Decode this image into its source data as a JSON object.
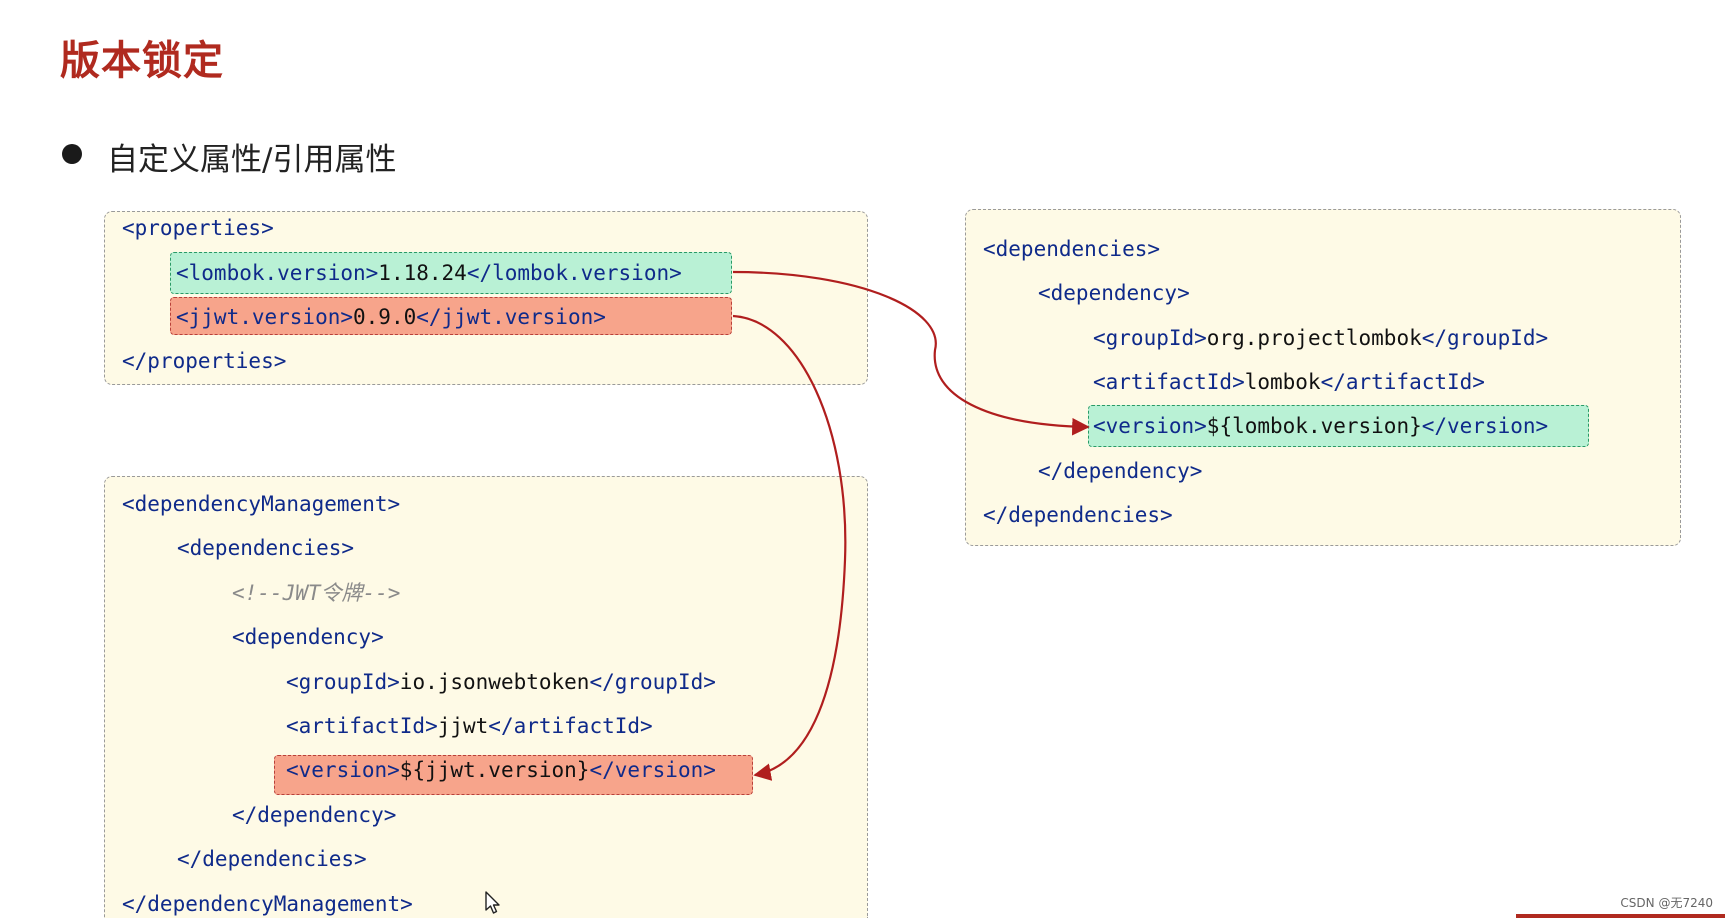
{
  "slide": {
    "title": "版本锁定",
    "bullet": "自定义属性/引用属性"
  },
  "properties_box": {
    "open_tag": "<properties>",
    "lombok_line": {
      "open": "<lombok.version>",
      "value": "1.18.24",
      "close": "</lombok.version>"
    },
    "jjwt_line": {
      "open": "<jjwt.version>",
      "value": "0.9.0",
      "close": "</jjwt.version>"
    },
    "close_tag": "</properties>"
  },
  "dependency_management_box": {
    "lines": [
      {
        "text": "<dependencyManagement>",
        "kind": "tag"
      },
      {
        "text": "<dependencies>",
        "kind": "tag"
      },
      {
        "text": "<!--JWT令牌-->",
        "kind": "comment"
      },
      {
        "text": "<dependency>",
        "kind": "tag"
      },
      {
        "open": "<groupId>",
        "value": "io.jsonwebtoken",
        "close": "</groupId>"
      },
      {
        "open": "<artifactId>",
        "value": "jjwt",
        "close": "</artifactId>"
      },
      {
        "open": "<version>",
        "value": "${jjwt.version}",
        "close": "</version>",
        "highlight": "red"
      },
      {
        "text": "</dependency>",
        "kind": "tag"
      },
      {
        "text": "</dependencies>",
        "kind": "tag"
      },
      {
        "text": "</dependencyManagement>",
        "kind": "tag"
      }
    ]
  },
  "dependencies_box": {
    "lines": [
      {
        "text": "<dependencies>",
        "kind": "tag"
      },
      {
        "text": "<dependency>",
        "kind": "tag"
      },
      {
        "open": "<groupId>",
        "value": "org.projectlombok",
        "close": "</groupId>"
      },
      {
        "open": "<artifactId>",
        "value": "lombok",
        "close": "</artifactId>"
      },
      {
        "open": "<version>",
        "value": "${lombok.version}",
        "close": "</version>",
        "highlight": "green"
      },
      {
        "text": "</dependency>",
        "kind": "tag"
      },
      {
        "text": "</dependencies>",
        "kind": "tag"
      }
    ]
  },
  "watermark": "CSDN @无7240",
  "colors": {
    "title": "#b02a1f",
    "tag": "#0f2a8a",
    "box_bg": "#fefae6",
    "highlight_green": "#b9f1d5",
    "highlight_red": "#f7a48b",
    "arrow": "#b01e1e"
  },
  "icons": {
    "cursor": "mouse-pointer-icon",
    "bullet": "bullet-dot"
  }
}
